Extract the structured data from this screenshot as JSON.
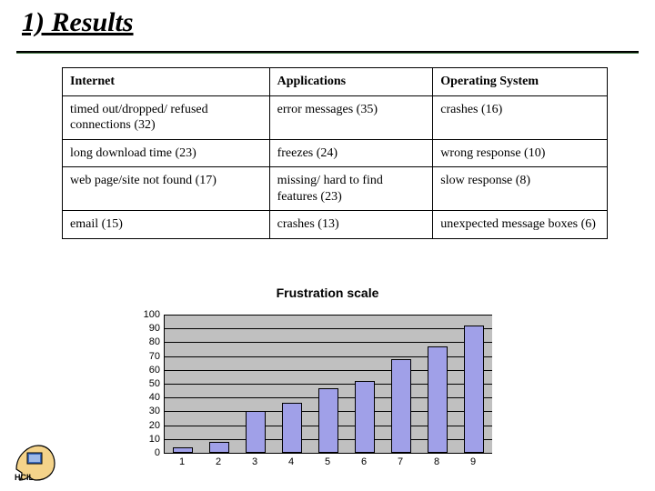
{
  "title": "1) Results",
  "table": {
    "headers": [
      "Internet",
      "Applications",
      "Operating System"
    ],
    "rows": [
      [
        "timed out/dropped/ refused connections (32)",
        "error messages (35)",
        "crashes (16)"
      ],
      [
        "long download time (23)",
        "freezes (24)",
        "wrong response (10)"
      ],
      [
        "web page/site not found  (17)",
        "missing/ hard to find features (23)",
        "slow response (8)"
      ],
      [
        "email (15)",
        "crashes (13)",
        "unexpected message boxes  (6)"
      ]
    ]
  },
  "chart_data": {
    "type": "bar",
    "title": "Frustration scale",
    "categories": [
      "1",
      "2",
      "3",
      "4",
      "5",
      "6",
      "7",
      "8",
      "9"
    ],
    "values": [
      4,
      8,
      30,
      36,
      47,
      52,
      68,
      77,
      92
    ],
    "xlabel": "",
    "ylabel": "",
    "ylim": [
      0,
      100
    ],
    "y_ticks": [
      0,
      10,
      20,
      30,
      40,
      50,
      60,
      70,
      80,
      90,
      100
    ]
  },
  "logo_alt": "HCIL logo"
}
